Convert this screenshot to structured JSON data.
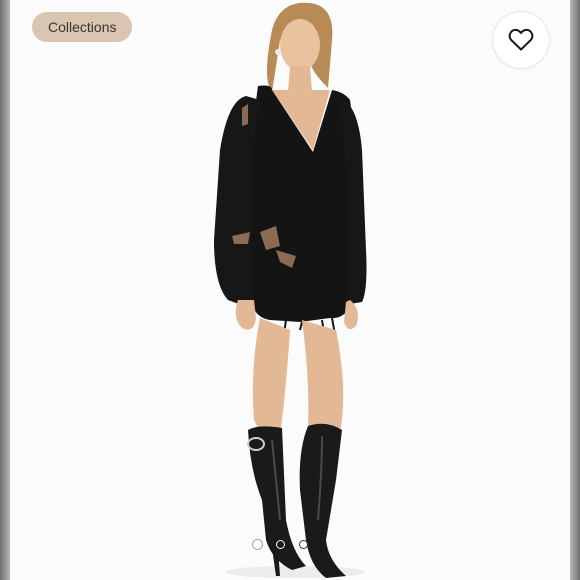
{
  "header": {
    "collections_label": "Collections"
  },
  "like": {
    "icon": "heart-outline-icon"
  },
  "carousel": {
    "slide_count": 3,
    "active_index": 0
  },
  "colors": {
    "chip_background": "#d9c5b2",
    "chip_text": "#3c332c",
    "garment": "#141414",
    "boots": "#1a1a1a"
  }
}
